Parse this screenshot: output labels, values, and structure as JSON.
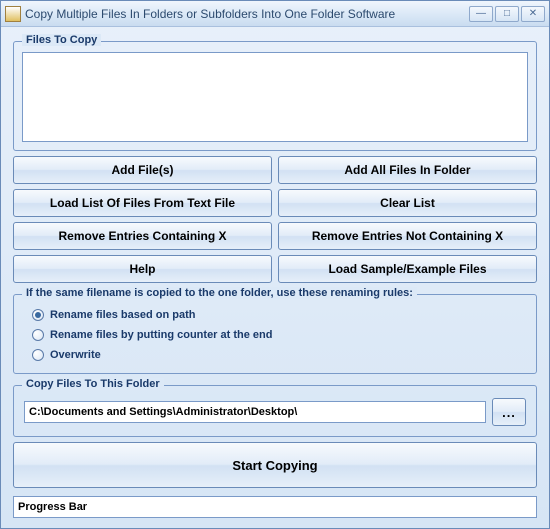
{
  "window": {
    "title": "Copy Multiple Files In Folders or Subfolders Into One Folder Software"
  },
  "files_group": {
    "legend": "Files To Copy"
  },
  "buttons": {
    "add_files": "Add File(s)",
    "add_all_folder": "Add All Files In Folder",
    "load_list": "Load List Of Files From Text File",
    "clear_list": "Clear List",
    "remove_containing": "Remove Entries Containing X",
    "remove_not_containing": "Remove Entries Not Containing X",
    "help": "Help",
    "load_sample": "Load Sample/Example Files",
    "browse": "...",
    "start": "Start Copying"
  },
  "rename_group": {
    "legend": "If the same filename is copied to the one folder, use these renaming rules:",
    "options": [
      {
        "label": "Rename files based on path",
        "checked": true
      },
      {
        "label": "Rename files by putting counter at the end",
        "checked": false
      },
      {
        "label": "Overwrite",
        "checked": false
      }
    ]
  },
  "dest_group": {
    "legend": "Copy Files To This Folder",
    "path": "C:\\Documents and Settings\\Administrator\\Desktop\\"
  },
  "progress": {
    "label": "Progress Bar"
  }
}
